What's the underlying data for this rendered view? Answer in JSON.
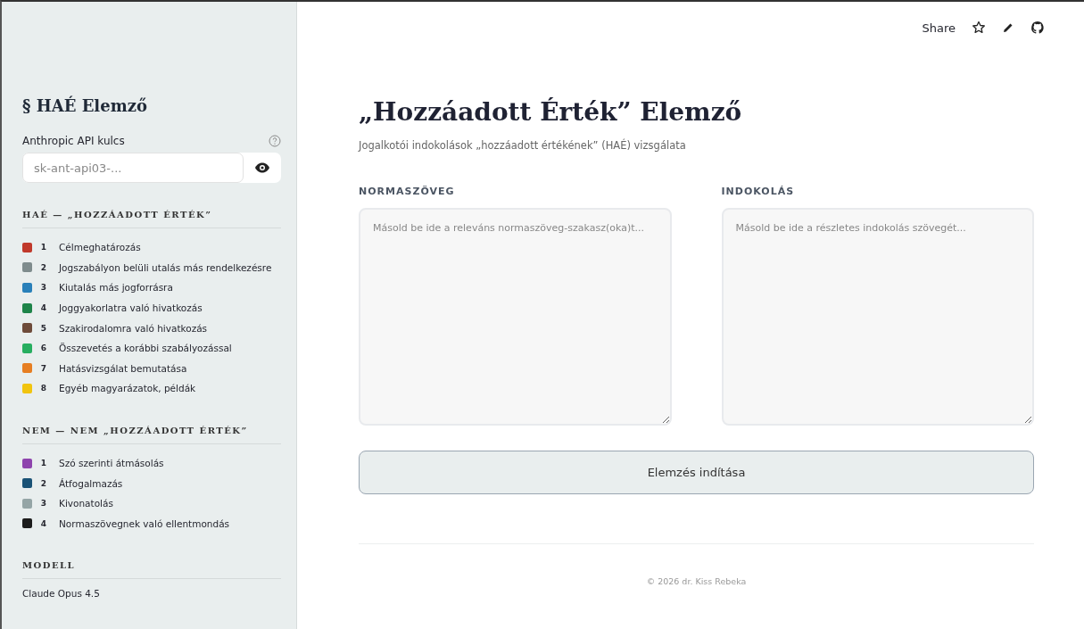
{
  "sidebar": {
    "title": "§ HAÉ Elemző",
    "api_key": {
      "label": "Anthropic API kulcs",
      "placeholder": "sk-ant-api03-..."
    },
    "sections": [
      {
        "heading": "HAÉ — „HOZZÁADOTT ÉRTÉK”",
        "items": [
          {
            "number": "1",
            "label": "Célmeghatározás",
            "color": "#c0392b"
          },
          {
            "number": "2",
            "label": "Jogszabályon belüli utalás más rendelkezésre",
            "color": "#7f8c8d"
          },
          {
            "number": "3",
            "label": "Kiutalás más jogforrásra",
            "color": "#2980b9"
          },
          {
            "number": "4",
            "label": "Joggyakorlatra való hivatkozás",
            "color": "#1e8449"
          },
          {
            "number": "5",
            "label": "Szakirodalomra való hivatkozás",
            "color": "#6e4b3a"
          },
          {
            "number": "6",
            "label": "Összevetés a korábbi szabályozással",
            "color": "#27ae60"
          },
          {
            "number": "7",
            "label": "Hatásvizsgálat bemutatása",
            "color": "#e67e22"
          },
          {
            "number": "8",
            "label": "Egyéb magyarázatok, példák",
            "color": "#f1c40f"
          }
        ]
      },
      {
        "heading": "NEM — NEM „HOZZÁADOTT ÉRTÉK”",
        "items": [
          {
            "number": "1",
            "label": "Szó szerinti átmásolás",
            "color": "#8e44ad"
          },
          {
            "number": "2",
            "label": "Átfogalmazás",
            "color": "#1a5276"
          },
          {
            "number": "3",
            "label": "Kivonatolás",
            "color": "#95a5a6"
          },
          {
            "number": "4",
            "label": "Normaszövegnek való ellentmondás",
            "color": "#1c1c1c"
          }
        ]
      }
    ],
    "model": {
      "heading": "MODELL",
      "value": "Claude Opus 4.5"
    }
  },
  "toolbar": {
    "share": "Share"
  },
  "main": {
    "title": "„Hozzáadott Érték” Elemző",
    "subtitle": "Jogalkotói indokolások „hozzáadott értékének” (HAÉ) vizsgálata",
    "fields": [
      {
        "label": "NORMASZÖVEG",
        "placeholder": "Másold be ide a releváns normaszöveg-szakasz(oka)t..."
      },
      {
        "label": "INDOKOLÁS",
        "placeholder": "Másold be ide a részletes indokolás szövegét..."
      }
    ],
    "button": "Elemzés indítása",
    "footer": "© 2026 dr. Kiss Rebeka"
  }
}
